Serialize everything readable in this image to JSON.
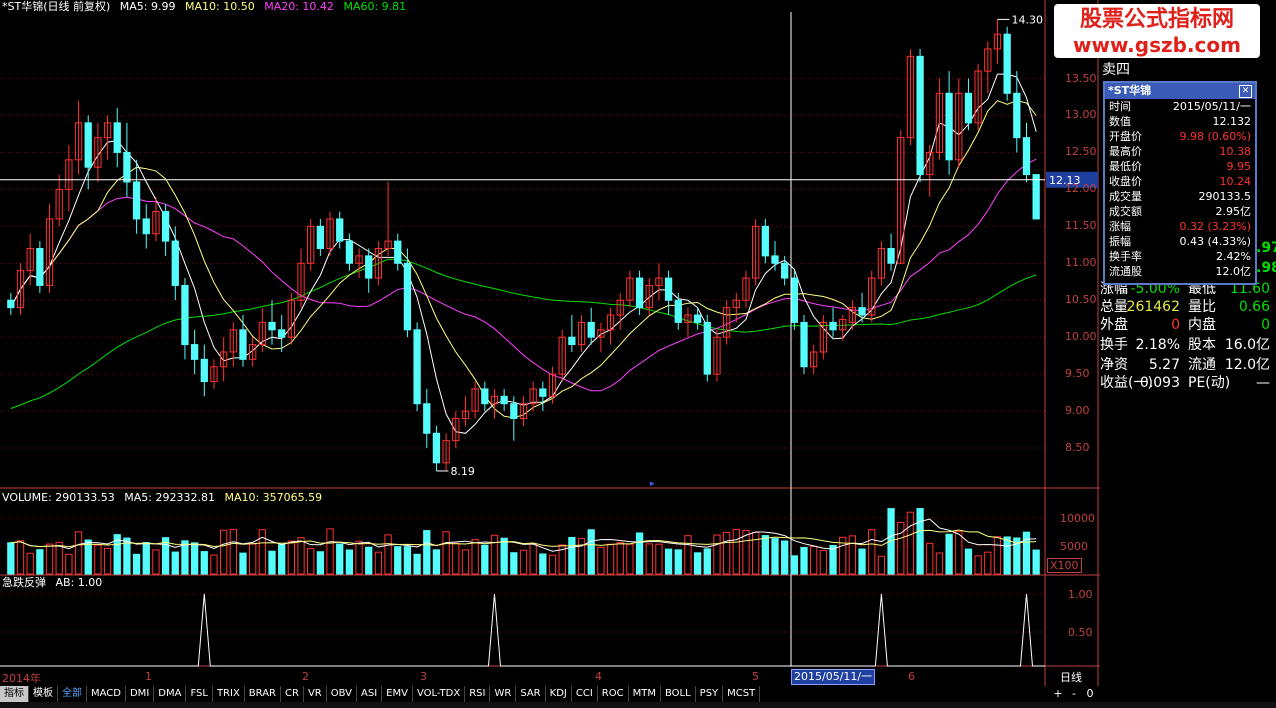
{
  "header": {
    "stock_name": "*ST华锦(日线 前复权)",
    "ma5": "MA5: 9.99",
    "ma10": "MA10: 10.50",
    "ma20": "MA20: 10.42",
    "ma60": "MA60: 9.81"
  },
  "colors": {
    "up": "#ff3232",
    "down": "#54fcfc",
    "ma5": "#ffffff",
    "ma10": "#ffff80",
    "ma20": "#ff40ff",
    "ma60": "#00e000",
    "grid": "#8b0000",
    "axis": "#c04040"
  },
  "price_axis": [
    "13.50",
    "13.00",
    "12.50",
    "12.00",
    "11.50",
    "11.00",
    "10.50",
    "10.00",
    "9.50",
    "9.00",
    "8.50"
  ],
  "price_marker": "12.13",
  "price_hi_label": "14.30",
  "price_lo_label": "8.19",
  "volume": {
    "header_label": "VOLUME: 290133.53",
    "ma5": "MA5: 292332.81",
    "ma10": "MA10: 357065.59",
    "axis": [
      "10000",
      "5000"
    ],
    "unit": "X100"
  },
  "indicator": {
    "header_label": "急跌反弹",
    "ab": "AB: 1.00",
    "axis": [
      "1.00",
      "0.50"
    ]
  },
  "x_axis": {
    "labels": [
      "2014年",
      "1",
      "2",
      "3",
      "4",
      "5",
      "6"
    ],
    "date_box": "2015/05/11/一",
    "period": "日线"
  },
  "watermark": {
    "line1": "股票公式指标网",
    "line2": "www.gszb.com"
  },
  "quote_panel": {
    "sell4": "卖四",
    "v1": ".97",
    "v2": ".98",
    "rows": [
      {
        "l1": "涨幅",
        "v1": "-5.00%",
        "l2": "最低",
        "v2": "11.60"
      },
      {
        "l1": "总量",
        "v1": "261462",
        "l2": "量比",
        "v2": "0.66"
      },
      {
        "l1": "外盘",
        "v1": "0",
        "l2": "内盘",
        "v2": "0"
      },
      {
        "l1": "换手",
        "v1": "2.18%",
        "l2": "股本",
        "v2": "16.0亿"
      },
      {
        "l1": "净资",
        "v1": "5.27",
        "l2": "流通",
        "v2": "12.0亿"
      },
      {
        "l1": "收益(一)",
        "v1": "0.093",
        "l2": "PE(动)",
        "v2": "—"
      }
    ]
  },
  "popup": {
    "title": "*ST华锦",
    "rows": [
      {
        "k": "时间",
        "v": "2015/05/11/一",
        "c": "#ffffff"
      },
      {
        "k": "数值",
        "v": "12.132",
        "c": "#ffffff"
      },
      {
        "k": "开盘价",
        "v": "9.98 (0.60%)",
        "c": "#ff3232"
      },
      {
        "k": "最高价",
        "v": "10.38",
        "c": "#ff3232"
      },
      {
        "k": "最低价",
        "v": "9.95",
        "c": "#ff3232"
      },
      {
        "k": "收盘价",
        "v": "10.24",
        "c": "#ff3232"
      },
      {
        "k": "成交量",
        "v": "290133.5",
        "c": "#ffffff"
      },
      {
        "k": "成交额",
        "v": "2.95亿",
        "c": "#ffffff"
      },
      {
        "k": "涨幅",
        "v": "0.32 (3.23%)",
        "c": "#ff3232"
      },
      {
        "k": "振幅",
        "v": "0.43 (4.33%)",
        "c": "#ffffff"
      },
      {
        "k": "换手率",
        "v": "2.42%",
        "c": "#ffffff"
      },
      {
        "k": "流通股",
        "v": "12.0亿",
        "c": "#ffffff"
      }
    ]
  },
  "tabs": [
    "指标",
    "模板",
    "全部",
    "MACD",
    "DMI",
    "DMA",
    "FSL",
    "TRIX",
    "BRAR",
    "CR",
    "VR",
    "OBV",
    "ASI",
    "EMV",
    "VOL-TDX",
    "RSI",
    "WR",
    "SAR",
    "KDJ",
    "CCI",
    "ROC",
    "MTM",
    "BOLL",
    "PSY",
    "MCST"
  ],
  "bottom_controls": [
    "+",
    "-",
    "0"
  ],
  "chart_data": {
    "type": "candlestick",
    "candles": [
      [
        10.5,
        10.6,
        10.3,
        10.4
      ],
      [
        10.4,
        11.0,
        10.3,
        10.9
      ],
      [
        10.9,
        11.4,
        10.7,
        11.2
      ],
      [
        11.2,
        11.3,
        10.6,
        10.7
      ],
      [
        10.7,
        11.8,
        10.6,
        11.6
      ],
      [
        11.6,
        12.2,
        11.5,
        12.0
      ],
      [
        12.0,
        12.6,
        11.7,
        12.4
      ],
      [
        12.4,
        13.2,
        12.2,
        12.9
      ],
      [
        12.9,
        13.0,
        12.0,
        12.3
      ],
      [
        12.3,
        12.9,
        12.1,
        12.7
      ],
      [
        12.7,
        13.0,
        12.4,
        12.9
      ],
      [
        12.9,
        13.1,
        12.3,
        12.5
      ],
      [
        12.5,
        12.9,
        11.9,
        12.1
      ],
      [
        12.1,
        12.4,
        11.4,
        11.6
      ],
      [
        11.6,
        11.8,
        11.2,
        11.4
      ],
      [
        11.4,
        11.9,
        11.3,
        11.7
      ],
      [
        11.7,
        11.8,
        11.1,
        11.3
      ],
      [
        11.3,
        11.5,
        10.5,
        10.7
      ],
      [
        10.7,
        10.8,
        9.7,
        9.9
      ],
      [
        9.9,
        10.1,
        9.5,
        9.7
      ],
      [
        9.7,
        9.9,
        9.2,
        9.4
      ],
      [
        9.4,
        9.7,
        9.3,
        9.6
      ],
      [
        9.6,
        10.0,
        9.4,
        9.8
      ],
      [
        9.8,
        10.2,
        9.6,
        10.1
      ],
      [
        10.1,
        10.3,
        9.6,
        9.7
      ],
      [
        9.7,
        10.0,
        9.6,
        9.9
      ],
      [
        9.9,
        10.4,
        9.8,
        10.2
      ],
      [
        10.2,
        10.5,
        9.9,
        10.1
      ],
      [
        10.1,
        10.3,
        9.8,
        10.0
      ],
      [
        10.0,
        10.6,
        9.9,
        10.5
      ],
      [
        10.5,
        11.2,
        10.4,
        11.0
      ],
      [
        11.0,
        11.6,
        10.9,
        11.5
      ],
      [
        11.5,
        11.6,
        11.1,
        11.2
      ],
      [
        11.2,
        11.7,
        11.1,
        11.6
      ],
      [
        11.6,
        11.7,
        11.2,
        11.3
      ],
      [
        11.3,
        11.4,
        10.9,
        11.0
      ],
      [
        11.0,
        11.2,
        10.8,
        11.1
      ],
      [
        11.1,
        11.2,
        10.6,
        10.8
      ],
      [
        10.8,
        11.3,
        10.7,
        11.2
      ],
      [
        11.2,
        12.1,
        11.1,
        11.3
      ],
      [
        11.3,
        11.4,
        10.9,
        11.0
      ],
      [
        11.0,
        11.2,
        10.0,
        10.1
      ],
      [
        10.1,
        10.2,
        9.0,
        9.1
      ],
      [
        9.1,
        9.3,
        8.5,
        8.7
      ],
      [
        8.7,
        8.8,
        8.19,
        8.3
      ],
      [
        8.3,
        8.7,
        8.2,
        8.6
      ],
      [
        8.6,
        9.0,
        8.5,
        8.9
      ],
      [
        8.9,
        9.2,
        8.8,
        9.0
      ],
      [
        9.0,
        9.4,
        8.9,
        9.3
      ],
      [
        9.3,
        9.4,
        9.0,
        9.1
      ],
      [
        9.1,
        9.3,
        8.9,
        9.2
      ],
      [
        9.2,
        9.3,
        9.0,
        9.1
      ],
      [
        9.1,
        9.2,
        8.6,
        8.9
      ],
      [
        8.9,
        9.2,
        8.8,
        9.1
      ],
      [
        9.1,
        9.4,
        9.0,
        9.3
      ],
      [
        9.3,
        9.4,
        9.0,
        9.2
      ],
      [
        9.2,
        9.6,
        9.1,
        9.5
      ],
      [
        9.5,
        10.1,
        9.4,
        10.0
      ],
      [
        10.0,
        10.3,
        9.8,
        9.9
      ],
      [
        9.9,
        10.3,
        9.8,
        10.2
      ],
      [
        10.2,
        10.4,
        9.9,
        10.0
      ],
      [
        10.0,
        10.2,
        9.8,
        10.1
      ],
      [
        10.1,
        10.4,
        9.9,
        10.3
      ],
      [
        10.3,
        10.6,
        10.1,
        10.5
      ],
      [
        10.5,
        10.9,
        10.4,
        10.8
      ],
      [
        10.8,
        10.9,
        10.3,
        10.4
      ],
      [
        10.4,
        10.8,
        10.3,
        10.7
      ],
      [
        10.7,
        11.0,
        10.5,
        10.8
      ],
      [
        10.8,
        10.9,
        10.3,
        10.5
      ],
      [
        10.5,
        10.6,
        10.1,
        10.2
      ],
      [
        10.2,
        10.4,
        10.0,
        10.3
      ],
      [
        10.3,
        10.4,
        10.1,
        10.2
      ],
      [
        10.2,
        10.3,
        9.4,
        9.5
      ],
      [
        9.5,
        10.1,
        9.4,
        10.0
      ],
      [
        10.0,
        10.5,
        9.9,
        10.4
      ],
      [
        10.4,
        10.6,
        10.2,
        10.5
      ],
      [
        10.5,
        10.9,
        10.4,
        10.8
      ],
      [
        10.8,
        11.6,
        10.7,
        11.5
      ],
      [
        11.5,
        11.6,
        11.0,
        11.1
      ],
      [
        11.1,
        11.3,
        10.9,
        11.0
      ],
      [
        11.0,
        11.1,
        10.7,
        10.8
      ],
      [
        10.8,
        10.9,
        10.1,
        10.2
      ],
      [
        10.2,
        10.3,
        9.5,
        9.6
      ],
      [
        9.6,
        9.9,
        9.5,
        9.8
      ],
      [
        9.8,
        10.3,
        9.7,
        10.2
      ],
      [
        10.2,
        10.4,
        10.0,
        10.1
      ],
      [
        10.1,
        10.3,
        9.95,
        10.24
      ],
      [
        10.2,
        10.5,
        10.1,
        10.4
      ],
      [
        10.4,
        10.6,
        10.2,
        10.3
      ],
      [
        10.3,
        10.9,
        10.2,
        10.8
      ],
      [
        10.8,
        11.3,
        10.7,
        11.2
      ],
      [
        11.2,
        11.4,
        10.9,
        11.0
      ],
      [
        11.0,
        12.8,
        11.0,
        12.7
      ],
      [
        12.7,
        13.9,
        12.6,
        13.8
      ],
      [
        13.8,
        13.9,
        12.1,
        12.2
      ],
      [
        12.2,
        12.6,
        11.9,
        12.5
      ],
      [
        12.5,
        13.5,
        12.4,
        13.3
      ],
      [
        13.3,
        13.6,
        12.2,
        12.4
      ],
      [
        12.4,
        13.5,
        12.3,
        13.3
      ],
      [
        13.3,
        13.5,
        12.8,
        12.9
      ],
      [
        12.9,
        13.7,
        12.8,
        13.6
      ],
      [
        13.6,
        14.0,
        13.3,
        13.9
      ],
      [
        13.9,
        14.3,
        13.7,
        14.1
      ],
      [
        14.1,
        14.2,
        13.2,
        13.3
      ],
      [
        13.3,
        13.6,
        12.5,
        12.7
      ],
      [
        12.7,
        12.9,
        12.1,
        12.2
      ],
      [
        12.2,
        12.2,
        11.6,
        11.6
      ]
    ],
    "volume_note": "volume bars approx. 2000-10000 (x100)",
    "y_range": [
      8.0,
      14.4
    ],
    "hi": 14.3,
    "lo": 8.19,
    "crosshair_value": 12.13,
    "indicator_spikes_index": [
      20,
      50,
      90,
      105
    ],
    "ab_value": 1.0
  }
}
